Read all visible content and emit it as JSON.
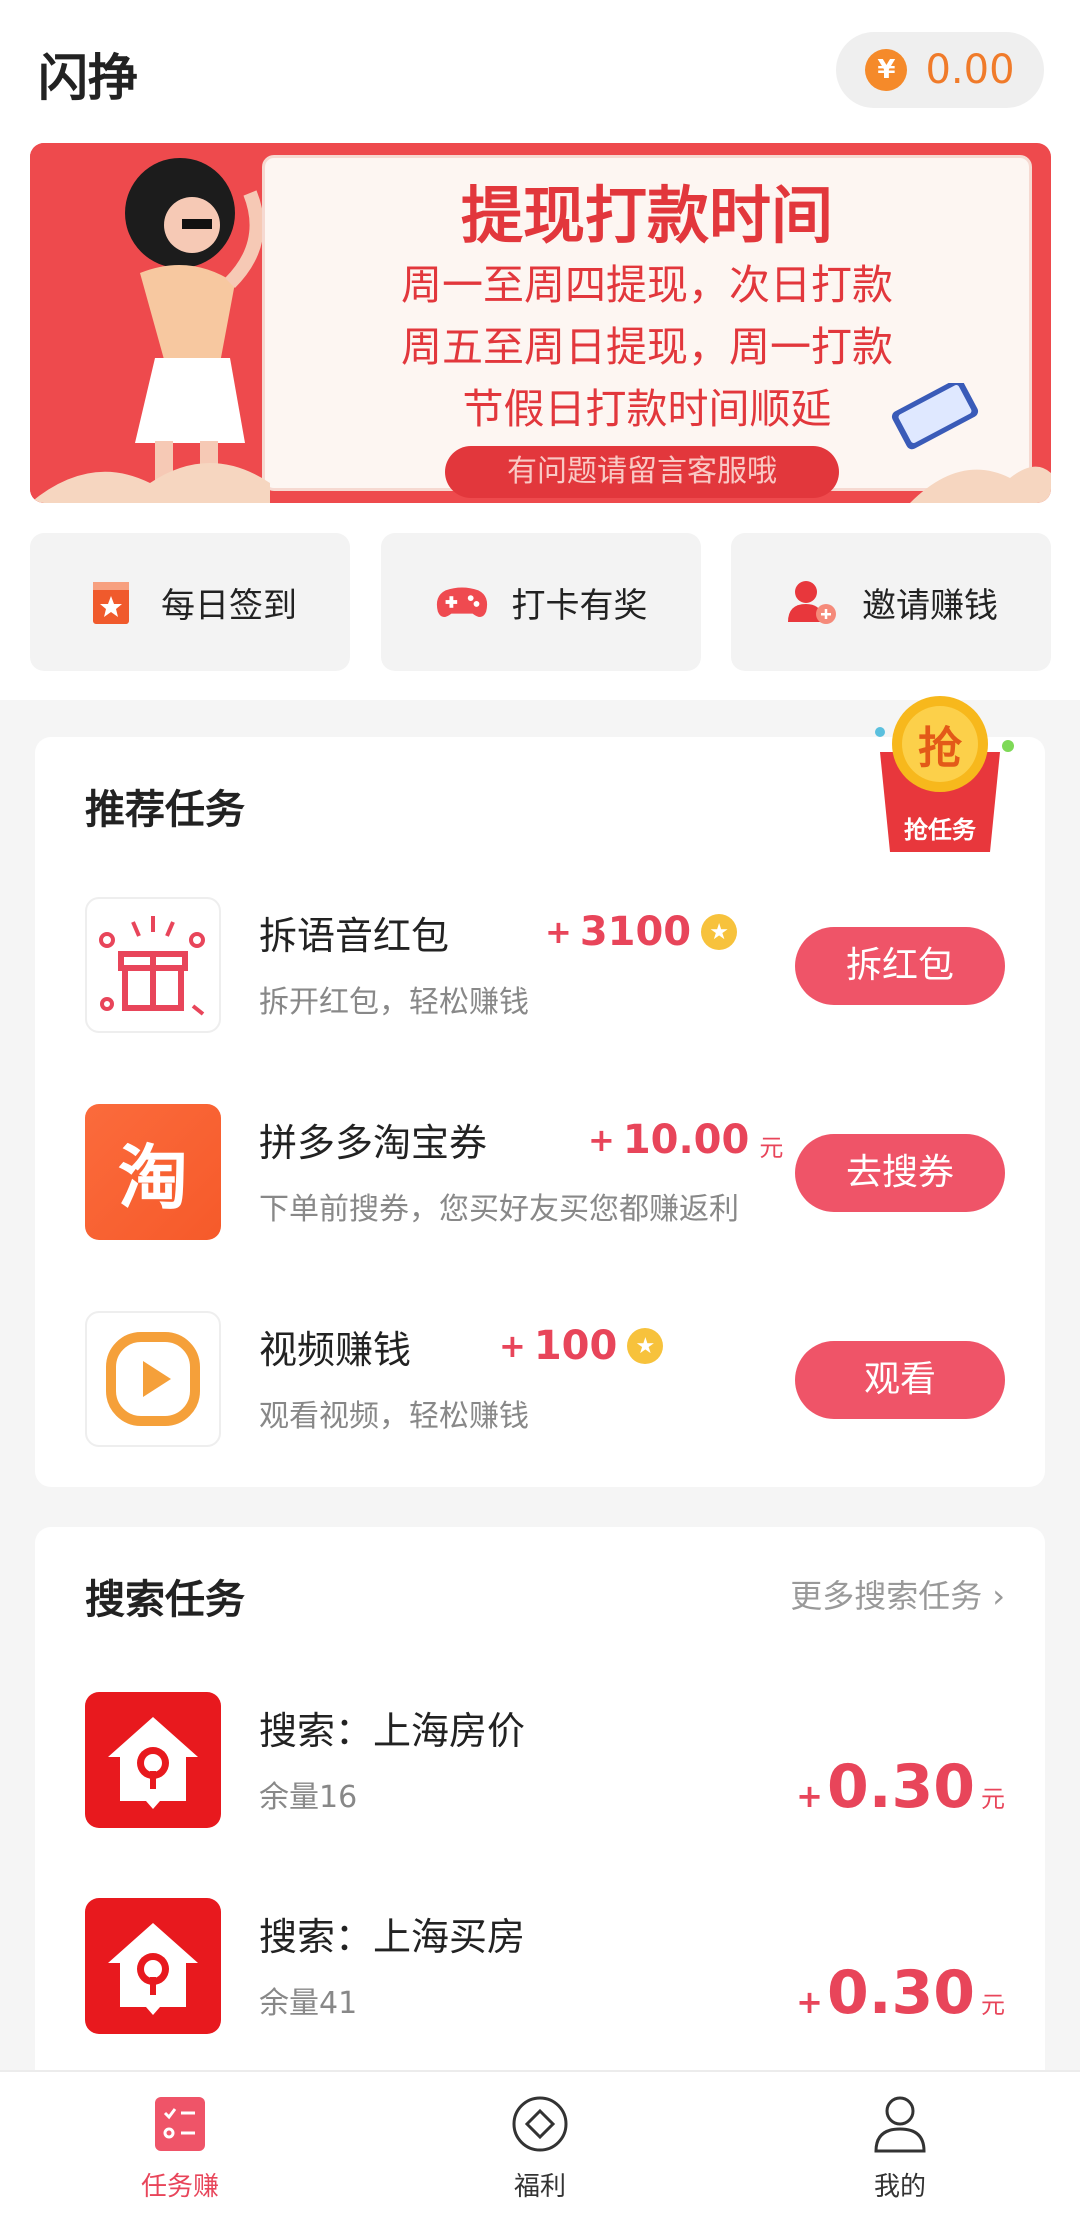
{
  "header": {
    "title": "闪挣",
    "balance": "0.00",
    "currency_symbol": "¥"
  },
  "banner": {
    "title": "提现打款时间",
    "lines": [
      "周一至周四提现，次日打款",
      "周五至周日提现，周一打款",
      "节假日打款时间顺延"
    ],
    "pill": "有问题请留言客服哦"
  },
  "shortcuts": [
    {
      "label": "每日签到",
      "icon": "calendar-star-icon"
    },
    {
      "label": "打卡有奖",
      "icon": "gamepad-icon"
    },
    {
      "label": "邀请赚钱",
      "icon": "invite-user-icon"
    }
  ],
  "recommended": {
    "title": "推荐任务",
    "badge": {
      "top": "抢",
      "bottom": "抢任务"
    },
    "tasks": [
      {
        "name": "拆语音红包",
        "plus": "+",
        "reward": "3100",
        "unit": "",
        "desc": "拆开红包，轻松赚钱",
        "button": "拆红包",
        "icon": "gift-icon"
      },
      {
        "name": "拼多多淘宝券",
        "plus": "+",
        "reward": "10.00",
        "unit": "元",
        "desc": "下单前搜券，您买好友买您都赚返利",
        "button": "去搜券",
        "icon": "taobao-icon",
        "icon_text": "淘"
      },
      {
        "name": "视频赚钱",
        "plus": "+",
        "reward": "100",
        "unit": "",
        "desc": "观看视频，轻松赚钱",
        "button": "观看",
        "icon": "play-icon"
      }
    ]
  },
  "search": {
    "title": "搜索任务",
    "more": "更多搜索任务",
    "tasks": [
      {
        "name": "搜索：上海房价",
        "remain": "余量16",
        "plus": "+",
        "reward": "0.30",
        "unit": "元",
        "icon": "house-pin-icon"
      },
      {
        "name": "搜索：上海买房",
        "remain": "余量41",
        "plus": "+",
        "reward": "0.30",
        "unit": "元",
        "icon": "house-pin-icon"
      }
    ]
  },
  "tabbar": [
    {
      "label": "任务赚",
      "icon": "task-list-icon",
      "active": true
    },
    {
      "label": "福利",
      "icon": "diamond-circle-icon",
      "active": false
    },
    {
      "label": "我的",
      "icon": "user-icon",
      "active": false
    }
  ],
  "colors": {
    "accent": "#ef5468",
    "reward": "#e8455a",
    "banner_red": "#e2373c",
    "coin": "#f58a2a"
  }
}
